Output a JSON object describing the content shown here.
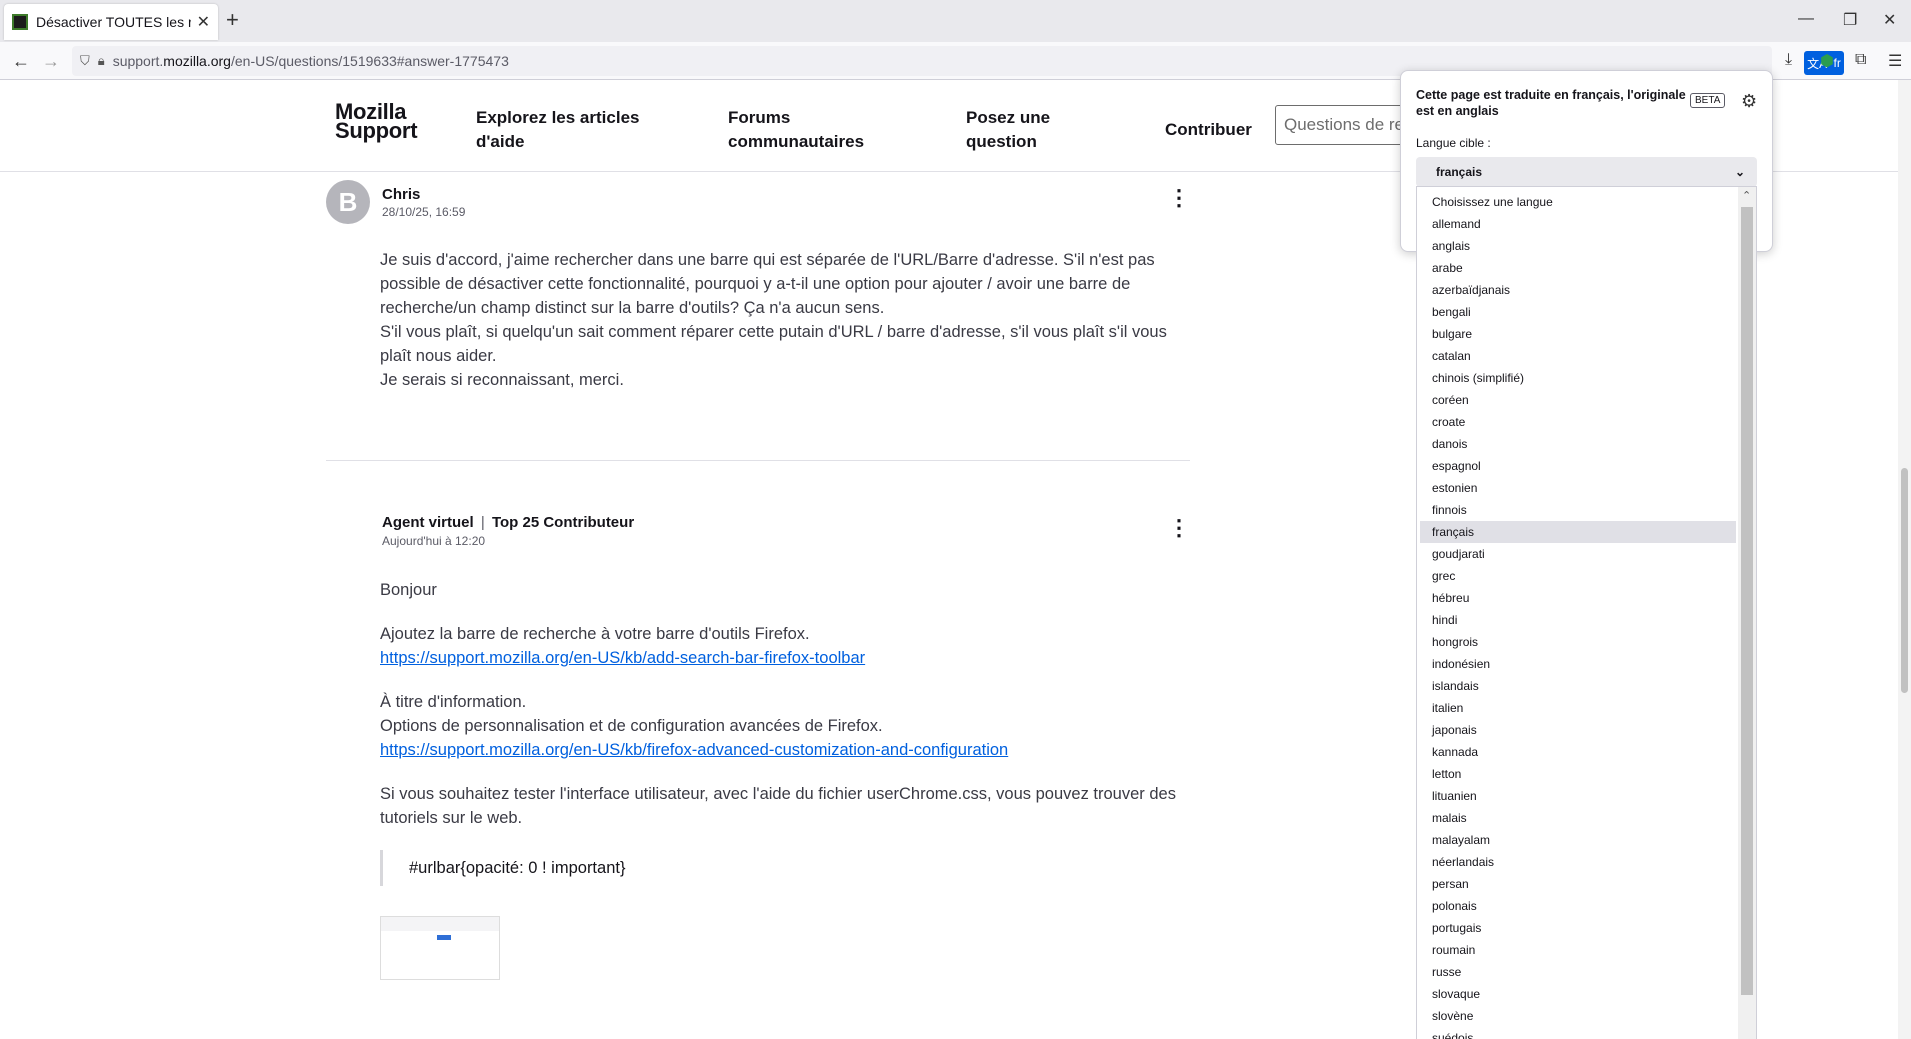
{
  "browser": {
    "tab_title": "Désactiver TOUTES les recherch",
    "url_host_prefix": "support.",
    "url_host_domain": "mozilla.org",
    "url_path": "/en-US/questions/1519633#answer-1775473",
    "translate_lang": "fr"
  },
  "site": {
    "logo_line1": "Mozilla",
    "logo_line2": "Support",
    "nav": [
      {
        "line1": "Explorez les articles",
        "line2": "d'aide"
      },
      {
        "line1": "Forums",
        "line2": "communautaires"
      },
      {
        "line1": "Posez une",
        "line2": "question"
      },
      {
        "line1": "Contribuer",
        "line2": ""
      }
    ],
    "search_placeholder": "Questions de re"
  },
  "posts": [
    {
      "avatar_letter": "B",
      "author": "Chris",
      "date": "28/10/25, 16:59",
      "paragraphs": [
        "Je suis d'accord, j'aime rechercher dans une barre qui est séparée de l'URL/Barre d'adresse. S'il n'est pas possible de désactiver cette fonctionnalité, pourquoi y a-t-il une option pour ajouter / avoir une barre de recherche/un champ distinct sur la barre d'outils? Ça n'a aucun sens.",
        "S'il vous plaît, si quelqu'un sait comment réparer cette putain d'URL / barre d'adresse, s'il vous plaît s'il vous plaît nous aider.",
        "Je serais si reconnaissant, merci."
      ]
    },
    {
      "author": "Agent virtuel",
      "badge": "Top 25 Contributeur",
      "date": "Aujourd'hui à 12:20",
      "greeting": "Bonjour",
      "p1": "Ajoutez la barre de recherche à votre barre d'outils Firefox.",
      "link1": "https://support.mozilla.org/en-US/kb/add-search-bar-firefox-toolbar",
      "p2a": "À titre d'information.",
      "p2b": "Options de personnalisation et de configuration avancées de Firefox.",
      "link2": "https://support.mozilla.org/en-US/kb/firefox-advanced-customization-and-configuration",
      "p3": "Si vous souhaitez tester l'interface utilisateur, avec l'aide du fichier userChrome.css, vous pouvez trouver des tutoriels sur le web.",
      "code": "#urlbar{opacité: 0 ! important}"
    }
  ],
  "translation_panel": {
    "title": "Cette page est traduite en français, l'originale est en anglais",
    "beta": "BETA",
    "target_label": "Langue cible :",
    "selected": "français",
    "options": [
      "Choisissez une langue",
      "allemand",
      "anglais",
      "arabe",
      "azerbaïdjanais",
      "bengali",
      "bulgare",
      "catalan",
      "chinois (simplifié)",
      "coréen",
      "croate",
      "danois",
      "espagnol",
      "estonien",
      "finnois",
      "français",
      "goudjarati",
      "grec",
      "hébreu",
      "hindi",
      "hongrois",
      "indonésien",
      "islandais",
      "italien",
      "japonais",
      "kannada",
      "letton",
      "lituanien",
      "malais",
      "malayalam",
      "néerlandais",
      "persan",
      "polonais",
      "portugais",
      "roumain",
      "russe",
      "slovaque",
      "slovène",
      "suédois"
    ]
  }
}
